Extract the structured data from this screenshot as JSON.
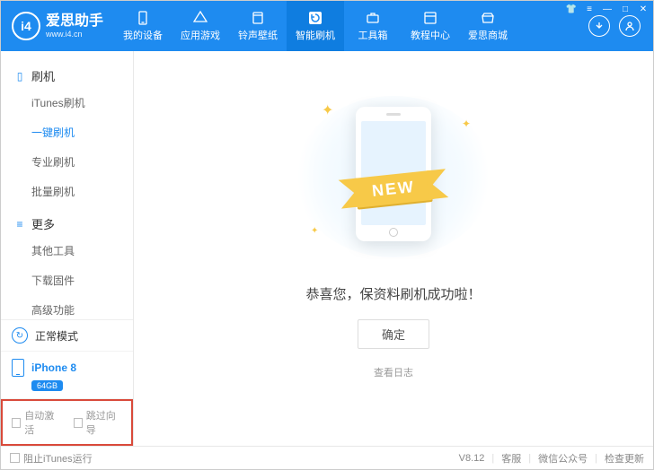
{
  "app": {
    "name": "爱思助手",
    "url": "www.i4.cn",
    "logo_text": "i4"
  },
  "nav": [
    {
      "label": "我的设备",
      "icon": "phone-icon"
    },
    {
      "label": "应用游戏",
      "icon": "app-icon"
    },
    {
      "label": "铃声壁纸",
      "icon": "music-icon"
    },
    {
      "label": "智能刷机",
      "icon": "refresh-icon",
      "active": true
    },
    {
      "label": "工具箱",
      "icon": "toolbox-icon"
    },
    {
      "label": "教程中心",
      "icon": "book-icon"
    },
    {
      "label": "爱思商城",
      "icon": "store-icon"
    }
  ],
  "sidebar": {
    "groups": [
      {
        "title": "刷机",
        "icon": "phone",
        "items": [
          "iTunes刷机",
          "一键刷机",
          "专业刷机",
          "批量刷机"
        ],
        "active_index": 1
      },
      {
        "title": "更多",
        "icon": "menu",
        "items": [
          "其他工具",
          "下载固件",
          "高级功能"
        ],
        "active_index": -1
      }
    ],
    "mode": {
      "label": "正常模式"
    },
    "device": {
      "name": "iPhone 8",
      "storage": "64GB"
    },
    "options": [
      {
        "label": "自动激活"
      },
      {
        "label": "跳过向导"
      }
    ]
  },
  "main": {
    "ribbon_text": "NEW",
    "success": "恭喜您，保资料刷机成功啦！",
    "ok_label": "确定",
    "log_label": "查看日志"
  },
  "footer": {
    "stop_itunes": "阻止iTunes运行",
    "version": "V8.12",
    "links": [
      "客服",
      "微信公众号",
      "检查更新"
    ]
  }
}
